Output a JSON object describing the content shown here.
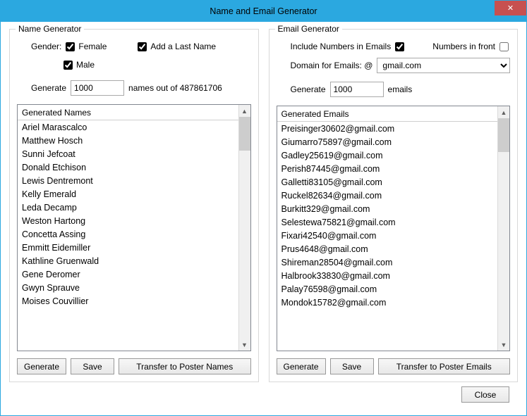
{
  "window": {
    "title": "Name and Email Generator",
    "close_label": "✕"
  },
  "name_panel": {
    "legend": "Name Generator",
    "gender_label": "Gender:",
    "female_label": "Female",
    "male_label": "Male",
    "add_lastname_label": "Add a Last Name",
    "generate_label": "Generate",
    "count_value": "1000",
    "out_of_text": "names out of  487861706",
    "list_header": "Generated Names",
    "items": [
      "Ariel Marascalco",
      "Matthew Hosch",
      "Sunni Jefcoat",
      "Donald Etchison",
      "Lewis Dentremont",
      "Kelly Emerald",
      "Leda Decamp",
      "Weston Hartong",
      "Concetta Assing",
      "Emmitt Eidemiller",
      "Kathline Gruenwald",
      "Gene Deromer",
      "Gwyn Sprauve",
      "Moises Couvillier"
    ],
    "btn_generate": "Generate",
    "btn_save": "Save",
    "btn_transfer": "Transfer to Poster Names"
  },
  "email_panel": {
    "legend": "Email Generator",
    "include_numbers_label": "Include Numbers in Emails",
    "numbers_front_label": "Numbers in front",
    "domain_label": "Domain for Emails: @",
    "domain_value": "gmail.com",
    "generate_label": "Generate",
    "count_value": "1000",
    "emails_suffix": "emails",
    "list_header": "Generated Emails",
    "items": [
      "Preisinger30602@gmail.com",
      "Giumarro75897@gmail.com",
      "Gadley25619@gmail.com",
      "Perish87445@gmail.com",
      "Galletti83105@gmail.com",
      "Ruckel82634@gmail.com",
      "Burkitt329@gmail.com",
      "Selestewa75821@gmail.com",
      "Fixari42540@gmail.com",
      "Prus4648@gmail.com",
      "Shireman28504@gmail.com",
      "Halbrook33830@gmail.com",
      "Palay76598@gmail.com",
      "Mondok15782@gmail.com"
    ],
    "btn_generate": "Generate",
    "btn_save": "Save",
    "btn_transfer": "Transfer to Poster Emails"
  },
  "footer": {
    "close_label": "Close"
  }
}
